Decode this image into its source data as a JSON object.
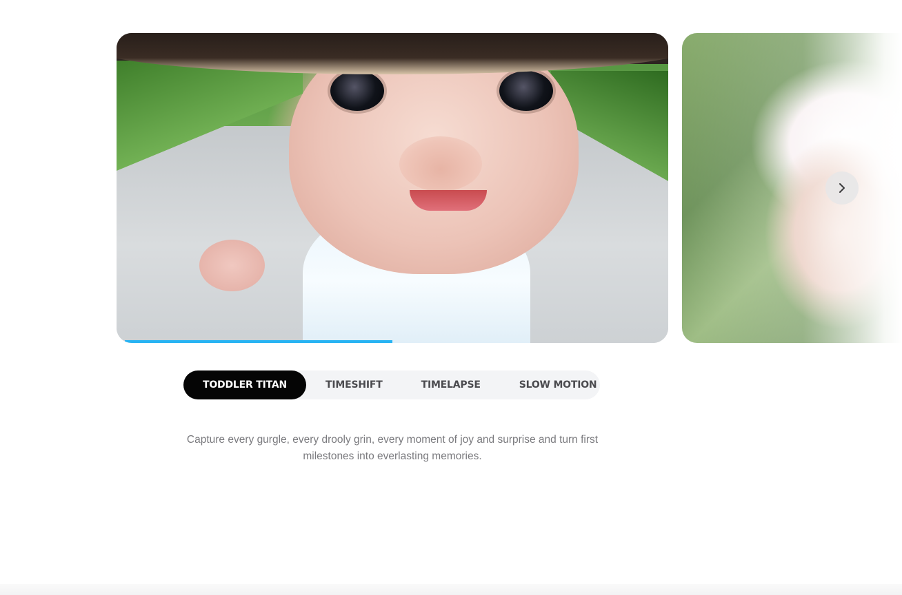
{
  "carousel": {
    "active_slide_progress": 0.5,
    "progress_color": "#27b3f3",
    "next_button_icon": "chevron-right-icon"
  },
  "tabs": [
    {
      "label": "TODDLER TITAN",
      "active": true
    },
    {
      "label": "TIMESHIFT",
      "active": false
    },
    {
      "label": "TIMELAPSE",
      "active": false
    },
    {
      "label": "SLOW MOTION",
      "active": false
    }
  ],
  "description": {
    "text": "Capture every gurgle, every drooly grin, every moment of joy and surprise and turn first milestones into everlasting memories."
  }
}
